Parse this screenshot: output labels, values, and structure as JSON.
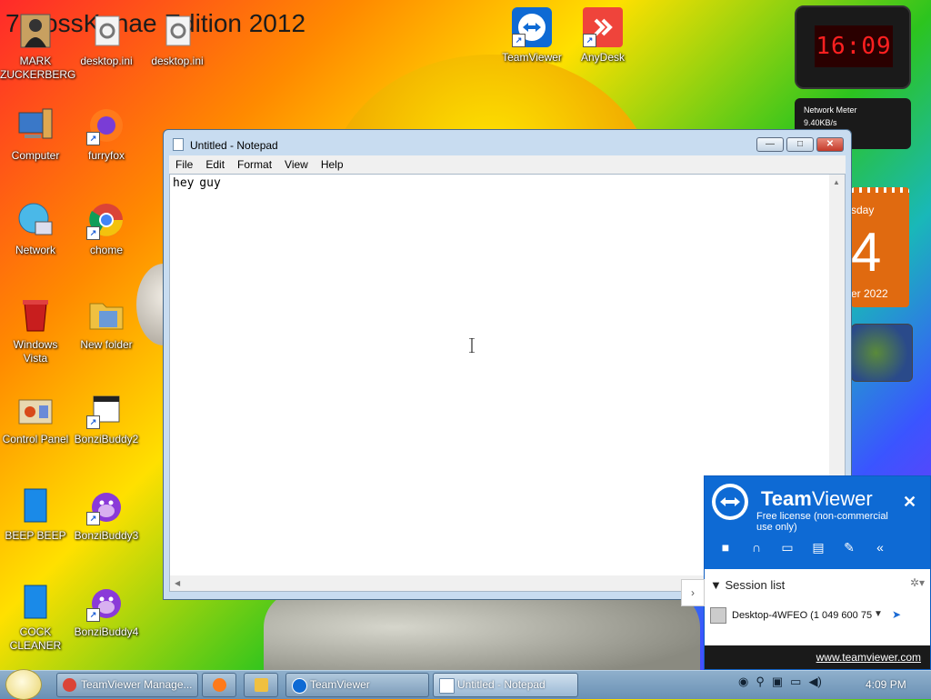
{
  "wallpaper": {
    "title": "7 BossKanae Edition 2012"
  },
  "desktop_icons": [
    {
      "label": "MARK\nZUCKERBERG",
      "icon": "person-icon"
    },
    {
      "label": "desktop.ini",
      "icon": "ini-file-icon"
    },
    {
      "label": "desktop.ini",
      "icon": "ini-file-icon"
    },
    {
      "label": "TeamViewer",
      "icon": "teamviewer-icon"
    },
    {
      "label": "AnyDesk",
      "icon": "anydesk-icon"
    },
    {
      "label": "Computer",
      "icon": "computer-icon"
    },
    {
      "label": "furryfox",
      "icon": "firefox-icon"
    },
    {
      "label": "Network",
      "icon": "network-icon"
    },
    {
      "label": "chome",
      "icon": "chrome-icon"
    },
    {
      "label": "Windows Vista",
      "icon": "recycle-bin-icon"
    },
    {
      "label": "New folder",
      "icon": "folder-icon"
    },
    {
      "label": "Control Panel",
      "icon": "control-panel-icon"
    },
    {
      "label": "BonziBuddy2",
      "icon": "film-file-icon"
    },
    {
      "label": "BEEP BEEP",
      "icon": "blue-app-icon"
    },
    {
      "label": "BonziBuddy3",
      "icon": "gorilla-icon"
    },
    {
      "label": "COCK CLEANER",
      "icon": "blue-app-icon"
    },
    {
      "label": "BonziBuddy4",
      "icon": "gorilla-icon"
    }
  ],
  "gadgets": {
    "clock": "16:09",
    "network_meter": {
      "title": "Network Meter",
      "value": "9.40KB/s"
    },
    "calendar": {
      "day": "sday",
      "date": "4",
      "month_year": "er 2022"
    }
  },
  "notepad": {
    "title": "Untitled - Notepad",
    "menu": [
      "File",
      "Edit",
      "Format",
      "View",
      "Help"
    ],
    "content": "hey guy",
    "controls": {
      "minimize": "—",
      "maximize": "□",
      "close": "✕"
    }
  },
  "teamviewer_panel": {
    "brand_team": "Team",
    "brand_viewer": "Viewer",
    "license": "Free license (non-commercial use only)",
    "close": "✕",
    "session_list_label": "Session list",
    "device": "Desktop-4WFEO (1 049 600 75",
    "link": "www.teamviewer.com",
    "collapse": "›"
  },
  "taskbar": {
    "items": [
      {
        "label": "TeamViewer Manage...",
        "icon": "chrome-icon"
      },
      {
        "label": "",
        "icon": "firefox-icon"
      },
      {
        "label": "",
        "icon": "explorer-icon"
      },
      {
        "label": "TeamViewer",
        "icon": "teamviewer-icon"
      },
      {
        "label": "Untitled - Notepad",
        "icon": "notepad-icon"
      }
    ],
    "time": "4:09 PM"
  },
  "colors": {
    "teamviewer_blue": "#0e6ad4",
    "clock_red": "#ff2020"
  }
}
